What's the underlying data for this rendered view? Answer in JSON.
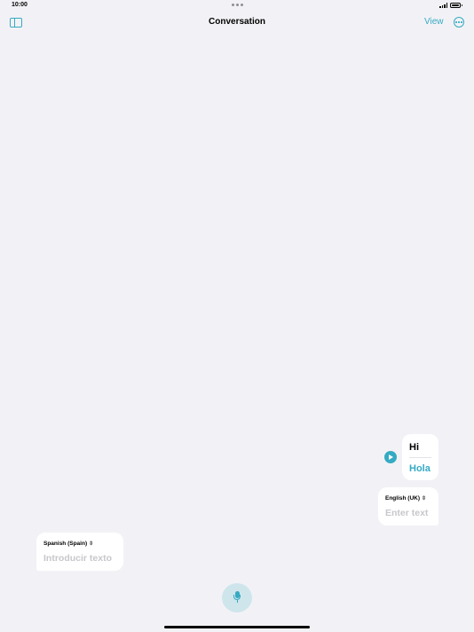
{
  "status_bar": {
    "time": "10:00"
  },
  "nav": {
    "title": "Conversation",
    "view_label": "View"
  },
  "conversation": {
    "source_text": "Hi",
    "translated_text": "Hola"
  },
  "inputs": {
    "english": {
      "language": "English (UK)",
      "placeholder": "Enter text"
    },
    "spanish": {
      "language": "Spanish (Spain)",
      "placeholder": "Introducir texto"
    }
  },
  "icons": {
    "chevron": "⇳"
  },
  "colors": {
    "accent": "#35aac3",
    "background": "#f2f2f6"
  }
}
